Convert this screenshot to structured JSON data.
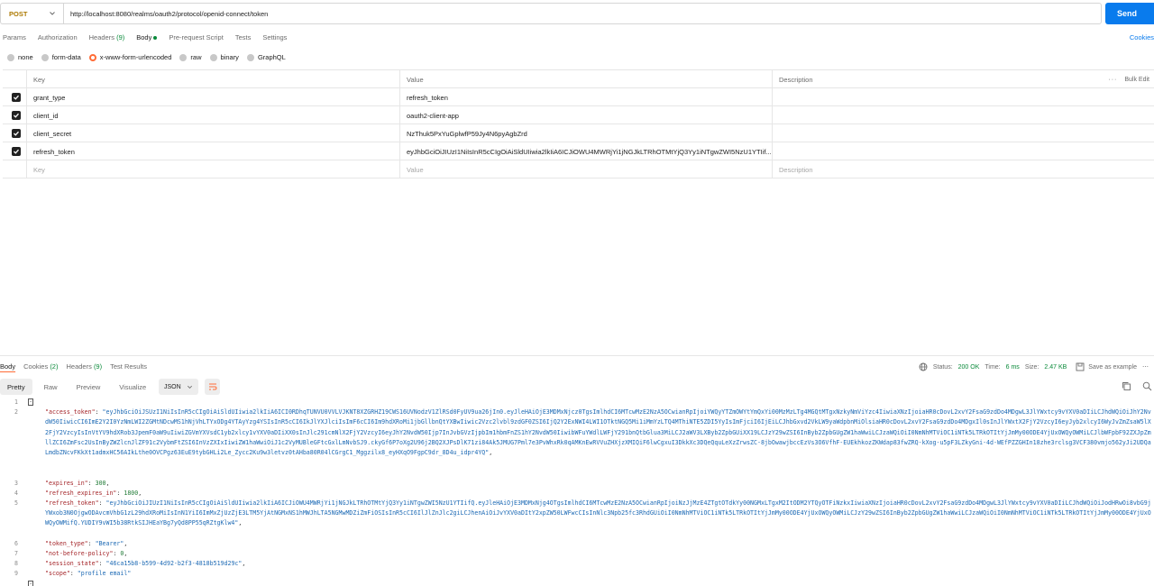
{
  "request": {
    "method": "POST",
    "url": "http://localhost:8080/realms/oauth2/protocol/openid-connect/token",
    "send_label": "Send"
  },
  "request_tabs": {
    "params": "Params",
    "authorization": "Authorization",
    "headers": "Headers",
    "headers_count": "(9)",
    "body": "Body",
    "prerequest": "Pre-request Script",
    "tests": "Tests",
    "settings": "Settings",
    "cookies": "Cookies"
  },
  "body_types": {
    "none": "none",
    "form_data": "form-data",
    "urlencoded": "x-www-form-urlencoded",
    "raw": "raw",
    "binary": "binary",
    "graphql": "GraphQL"
  },
  "table": {
    "header": {
      "key": "Key",
      "value": "Value",
      "description": "Description",
      "bulk_edit": "Bulk Edit"
    },
    "rows": [
      {
        "key": "grant_type",
        "value": "refresh_token"
      },
      {
        "key": "client_id",
        "value": "oauth2-client-app"
      },
      {
        "key": "client_secret",
        "value": "NzThuk5PxYuGplwfP59Jy4N6pyAgbZrd"
      },
      {
        "key": "refresh_token",
        "value": "eyJhbGciOiJIUzI1NiIsInR5cCIgOiAiSldUIiwia2lkIiA6ICJiOWU4MWRjYi1jNGJkLTRhOTMtYjQ3Yy1iNTgwZWI5NzU1YTIif..."
      }
    ],
    "placeholder": {
      "key": "Key",
      "value": "Value",
      "description": "Description"
    }
  },
  "response": {
    "tabs": {
      "body": "Body",
      "cookies": "Cookies",
      "cookies_count": "(2)",
      "headers": "Headers",
      "headers_count": "(9)",
      "test_results": "Test Results"
    },
    "status_label": "Status:",
    "status_value": "200 OK",
    "time_label": "Time:",
    "time_value": "6 ms",
    "size_label": "Size:",
    "size_value": "2.47 KB",
    "save_example": "Save as example",
    "view_tabs": {
      "pretty": "Pretty",
      "raw": "Raw",
      "preview": "Preview",
      "visualize": "Visualize"
    },
    "format": "JSON"
  },
  "code": {
    "line_numbers": [
      "1",
      "2",
      "3",
      "4",
      "5",
      "6",
      "7",
      "8",
      "9"
    ],
    "access_token_key": "\"access_token\"",
    "access_token_value": "\"eyJhbGciOiJSUzI1NiIsInR5cCIgOiAiSldUIiwia2lkIiA6ICI0RDhqTUNVU0VVLVJKNT8XZGRHZ19CWS16UVNodzV1ZlRSd0FyUV9ua26jIn0.eyJleHAiOjE3MDMxNjcz0TgsImlhdCI6MTcwMzE2NzA5OCwianRpIjoiYWQyYTZmOWYtYmQxYi00MzMzLTg4MGQtMTgxNzkyNmViYzc4IiwiaXNzIjoiaHR0cDovL2xvY2FsaG9zdDo4MDgwL3JlYWxtcy9vYXV0aDIiLCJhdWQiOiJhY2NvdW50IiwicCI6ImE2Y2I0YzNmLWI2ZGMtNDcwMS1hNjVhLTYxODg4YTAyYzg4YSIsInR5cCI6IkJlYXJlciIsImF6cCI6Im9hdXRoMi1jbGllbnQtYXBwIiwic2Vzc2lvbl9zdGF0ZSI6IjQ2Y2ExNWI4LWI1OTktNGQ5Mi1iMmYzLTQ4MThiNTE5ZDI5YyIsImFjciI6IjEiLCJhbGxvd2VkLW9yaWdpbnMiOlsiaHR0cDovL2xvY2FsaG9zdDo4MDgxIl0sInJlYWxtX2FjY2VzcyI6eyJyb2xlcyI6WyJvZmZsaW5lX2FjY2VzcyIsInVtYV9hdXRob3JpemF0aW9uIiwiZGVmYXVsdC1yb2xlcy1vYXV0aDIiXX0sInJlc291cmNlX2FjY2VzcyI6eyJhY2NvdW50Ijp7InJvbGVzIjpbIm1hbmFnZS1hY2NvdW50IiwibWFuYWdlLWFjY291bnQtbGlua3MiLCJ2aWV3LXByb2ZpbGUiXX19LCJzY29wZSI6InByb2ZpbGUgZW1haWwiLCJzaWQiOiI0NmNhMTViOC1iNTk5LTRkOTItYjJmMy00ODE4YjUxOWQyOWMiLCJlbWFpbF92ZXJpZmllZCI6ZmFsc2UsInByZWZlcnJlZF91c2VybmFtZSI6InVzZXIxIiwiZW1haWwiOiJ1c2VyMUBleGFtcGxlLmNvbSJ9.ckyGf6P7oXg2U96j2BQ2XJPsDlK71zi84Ak5JMUG7Pml7e3PvWhxRk0qAMKnEwRVVuZHXjzXMIQiF6lwCgxuI3DkkXc3DQeQquLeXzZrwsZC-8jbOwawjbccEzVs3O6VfhF-EUEkhkozZKWdap83fwZRQ-kXog-u5pF3LZkyGni-4d-WEfPZZGHIn18zhe3rclsg3VCF380vmjo562yJi2UDQaLmdbZNcvFKkXt1admxHC56AIkLthe0OVCPgz63EuE9tybGHLi2Le_Zycc2Ku9w3letvz0tAHba80R04lCGrgC1_Mggzilx8_eyHXqO9FgpC9dr_8D4u_idpr4YQ\"",
    "expires_in_key": "\"expires_in\"",
    "expires_in_value": "300",
    "refresh_expires_in_key": "\"refresh_expires_in\"",
    "refresh_expires_in_value": "1800",
    "refresh_token_key": "\"refresh_token\"",
    "refresh_token_value": "\"eyJhbGciOiJIUzI1NiIsInR5cCIgOiAiSldUIiwia2lkIiA6ICJiOWU4MWRjYi1jNGJkLTRhOTMtYjQ3Yy1iNTgwZWI5NzU1YTIifQ.eyJleHAiOjE3MDMxNjg4OTgsImlhdCI6MTcwMzE2NzA5OCwianRpIjoiNzJjMzE4ZTgtOTdkYy00NGMxLTgxM2ItODM2YTQyOTFiNzkxIiwiaXNzIjoiaHR0cDovL2xvY2FsaG9zdDo4MDgwL3JlYWxtcy9vYXV0aDIiLCJhdWQiOiJodHRwOi8vbG9jYWxob3N0OjgwODAvcmVhbG1zL29hdXRoMiIsInN1YiI6ImMxZjUzZjE3LTM5YjAtNGMxNS1hMWJhLTA5NGMwMDZiZmFiOSIsInR5cCI6IlJlZnJlc2giLCJhenAiOiJvYXV0aDItY2xpZW50LWFwcCIsInNlc3Npb25fc3RhdGUiOiI0NmNhMTViOC1iNTk5LTRkOTItYjJmMy00ODE4YjUxOWQyOWMiLCJzY29wZSI6InByb2ZpbGUgZW1haWwiLCJzaWQiOiI0NmNhMTViOC1iNTk5LTRkOTItYjJmMy00ODE4YjUxOWQyOWMifQ.YUDIY9vWI5b38RtkSIJHEaYBg7yQd8PP55qRZtgKlw4\"",
    "token_type_key": "\"token_type\"",
    "token_type_value": "\"Bearer\"",
    "not_before_policy_key": "\"not-before-policy\"",
    "not_before_policy_value": "0",
    "session_state_key": "\"session_state\"",
    "session_state_value": "\"46ca15b8-b599-4d92-b2f3-4818b519d29c\"",
    "scope_key": "\"scope\"",
    "scope_value": "\"profile email\"",
    "open_brace": "{",
    "close_brace": "}"
  },
  "colors": {
    "accent_send": "#097bed",
    "method_post": "#ad7a03",
    "status_ok": "#0a8a3a",
    "active_indicator": "#ff6c37"
  }
}
